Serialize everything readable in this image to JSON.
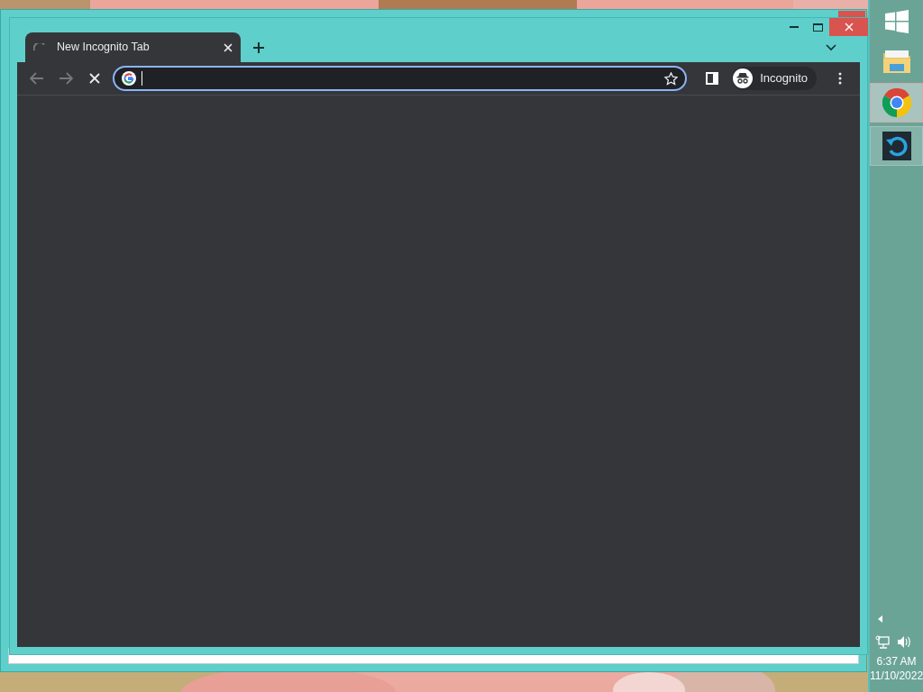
{
  "browser": {
    "tabs": [
      {
        "title": "New Incognito Tab",
        "selected": true,
        "loading": true
      }
    ],
    "profile": {
      "label": "Incognito"
    }
  },
  "taskbar": {
    "items": [
      {
        "kind": "start",
        "selected": false
      },
      {
        "kind": "folder",
        "selected": false
      },
      {
        "kind": "chrome",
        "selected": true
      },
      {
        "kind": "sync",
        "selected": false
      }
    ],
    "clock": {
      "time": "6:37 AM",
      "date": "11/10/2022"
    }
  }
}
